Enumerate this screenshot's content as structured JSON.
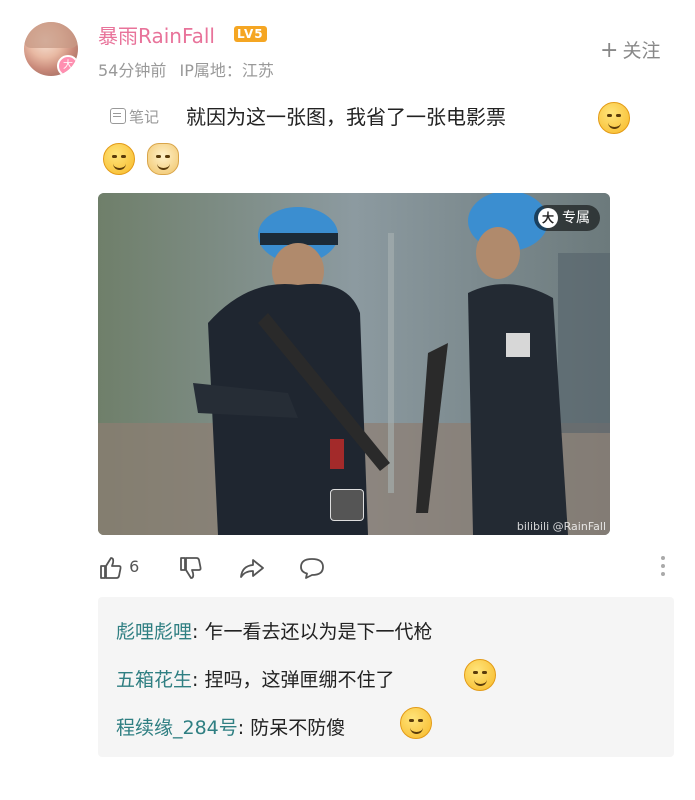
{
  "user": {
    "name": "暴雨RainFall",
    "level": "LV5",
    "avatar_badge": "大",
    "time": "54分钟前",
    "ip_location": "IP属地：江苏"
  },
  "follow": {
    "plus": "+",
    "label": "关注"
  },
  "post": {
    "note_label": "笔记",
    "text": "就因为这一张图，我省了一张电影票",
    "emojis": [
      "dizzy-face-emoji",
      "facepalm-emoji",
      "doge-emoji"
    ]
  },
  "image": {
    "tag_icon": "大",
    "tag_label": "专属",
    "watermark": "bilibili @RainFall"
  },
  "actions": {
    "like_count": "6"
  },
  "replies": [
    {
      "name": "彪哩彪哩",
      "text": ": 乍一看去还以为是下一代枪"
    },
    {
      "name": "五箱花生",
      "text": ": 捏吗，这弹匣绷不住了"
    },
    {
      "name": "程续缘_284号",
      "text": ": 防呆不防傻"
    }
  ],
  "colors": {
    "username": "#e8739a",
    "level_badge": "#f5a623",
    "reply_name": "#2f7f82",
    "reply_bg": "#f5f5f5"
  }
}
